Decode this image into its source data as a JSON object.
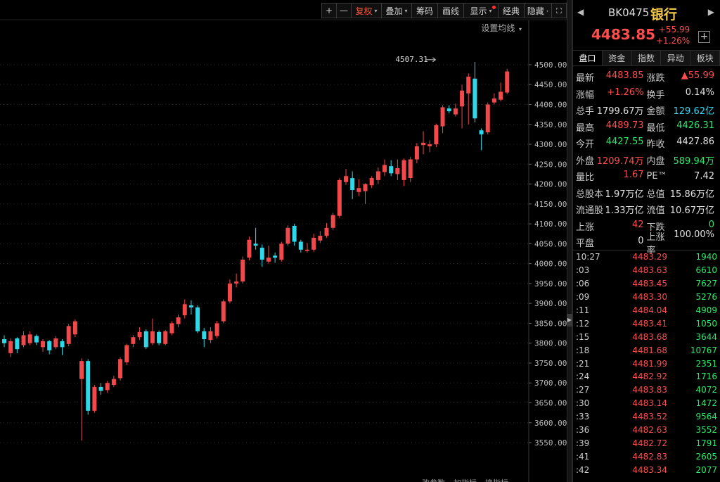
{
  "toolbar": {
    "items": [
      "+",
      "—",
      "复权",
      "叠加",
      "筹码",
      "画线",
      "显示",
      "经典",
      "隐藏"
    ],
    "active_index": 2,
    "fullscreen_icon": "expand-icon"
  },
  "ma_setting_label": "设置均线",
  "bottom_tabs": [
    "改参数",
    "加指标",
    "换指标"
  ],
  "chart_data": {
    "type": "candlestick",
    "ylim": [
      3520,
      4530
    ],
    "yticks": [
      4500,
      4450,
      4400,
      4350,
      4300,
      4250,
      4200,
      4150,
      4100,
      4050,
      4000,
      3950,
      3900,
      3850,
      3800,
      3750,
      3700,
      3650,
      3600,
      3550
    ],
    "ytick_labels": [
      "4500.00",
      "4450.00",
      "4400.00",
      "4350.00",
      "4300.00",
      "4250.00",
      "4200.00",
      "4150.00",
      "4100.00",
      "4050.00",
      "4000.00",
      "3950.00",
      "3900.00",
      "3850.00",
      "3800.00",
      "3750.00",
      "3700.00",
      "3650.00",
      "3600.00",
      "3550.00"
    ],
    "max_annotation": {
      "label": "4507.31",
      "value": 4507.31,
      "index": 67
    },
    "candles": [
      [
        3810,
        3800,
        3820,
        3790
      ],
      [
        3775,
        3805,
        3812,
        3765
      ],
      [
        3812,
        3785,
        3815,
        3775
      ],
      [
        3795,
        3820,
        3830,
        3790
      ],
      [
        3800,
        3822,
        3830,
        3795
      ],
      [
        3818,
        3802,
        3822,
        3795
      ],
      [
        3790,
        3805,
        3810,
        3778
      ],
      [
        3805,
        3782,
        3808,
        3772
      ],
      [
        3790,
        3812,
        3818,
        3785
      ],
      [
        3805,
        3790,
        3810,
        3770
      ],
      [
        3798,
        3843,
        3848,
        3792
      ],
      [
        3822,
        3855,
        3860,
        3815
      ],
      [
        3710,
        3755,
        3762,
        3555
      ],
      [
        3755,
        3630,
        3760,
        3620
      ],
      [
        3630,
        3690,
        3695,
        3625
      ],
      [
        3690,
        3680,
        3700,
        3670
      ],
      [
        3682,
        3700,
        3705,
        3675
      ],
      [
        3695,
        3710,
        3718,
        3690
      ],
      [
        3712,
        3760,
        3765,
        3706
      ],
      [
        3752,
        3795,
        3798,
        3745
      ],
      [
        3798,
        3815,
        3820,
        3790
      ],
      [
        3815,
        3828,
        3840,
        3808
      ],
      [
        3830,
        3790,
        3835,
        3785
      ],
      [
        3800,
        3830,
        3862,
        3795
      ],
      [
        3828,
        3800,
        3832,
        3795
      ],
      [
        3798,
        3830,
        3833,
        3795
      ],
      [
        3825,
        3850,
        3855,
        3820
      ],
      [
        3848,
        3865,
        3872,
        3840
      ],
      [
        3870,
        3898,
        3910,
        3862
      ],
      [
        3895,
        3890,
        3908,
        3872
      ],
      [
        3890,
        3830,
        3895,
        3825
      ],
      [
        3830,
        3810,
        3838,
        3790
      ],
      [
        3808,
        3830,
        3840,
        3800
      ],
      [
        3818,
        3850,
        3856,
        3812
      ],
      [
        3855,
        3905,
        3910,
        3850
      ],
      [
        3905,
        3950,
        3960,
        3900
      ],
      [
        3950,
        3955,
        3975,
        3940
      ],
      [
        3955,
        4010,
        4018,
        3950
      ],
      [
        4015,
        4060,
        4068,
        4008
      ],
      [
        4050,
        4045,
        4090,
        4035
      ],
      [
        4040,
        4010,
        4048,
        3992
      ],
      [
        4005,
        4015,
        4045,
        4000
      ],
      [
        4020,
        4015,
        4028,
        4002
      ],
      [
        4010,
        4050,
        4055,
        4005
      ],
      [
        4050,
        4090,
        4096,
        4045
      ],
      [
        4095,
        4055,
        4100,
        4045
      ],
      [
        4055,
        4035,
        4060,
        4028
      ],
      [
        4032,
        4035,
        4052,
        4028
      ],
      [
        4035,
        4065,
        4075,
        4030
      ],
      [
        4058,
        4070,
        4082,
        4052
      ],
      [
        4070,
        4090,
        4102,
        4065
      ],
      [
        4090,
        4122,
        4128,
        4085
      ],
      [
        4120,
        4210,
        4215,
        4115
      ],
      [
        4205,
        4220,
        4238,
        4198
      ],
      [
        4215,
        4185,
        4232,
        4162
      ],
      [
        4180,
        4190,
        4212,
        4170
      ],
      [
        4182,
        4200,
        4202,
        4150
      ],
      [
        4197,
        4215,
        4220,
        4190
      ],
      [
        4210,
        4232,
        4242,
        4200
      ],
      [
        4230,
        4248,
        4262,
        4220
      ],
      [
        4245,
        4227,
        4260,
        4220
      ],
      [
        4225,
        4240,
        4262,
        4210
      ],
      [
        4210,
        4260,
        4264,
        4195
      ],
      [
        4215,
        4262,
        4268,
        4205
      ],
      [
        4262,
        4295,
        4303,
        4252
      ],
      [
        4298,
        4304,
        4333,
        4275
      ],
      [
        4295,
        4300,
        4310,
        4280
      ],
      [
        4300,
        4348,
        4352,
        4293
      ],
      [
        4345,
        4393,
        4398,
        4328
      ],
      [
        4390,
        4383,
        4398,
        4378
      ],
      [
        4375,
        4390,
        4402,
        4370
      ],
      [
        4395,
        4435,
        4450,
        4340
      ],
      [
        4428,
        4470,
        4478,
        4350
      ],
      [
        4465,
        4365,
        4507,
        4355
      ],
      [
        4335,
        4325,
        4340,
        4285
      ],
      [
        4330,
        4400,
        4405,
        4325
      ],
      [
        4405,
        4415,
        4428,
        4400
      ],
      [
        4412,
        4432,
        4455,
        4408
      ],
      [
        4430,
        4483,
        4490,
        4426
      ]
    ]
  },
  "panel": {
    "nav_left_icon": "triangle-left-icon",
    "nav_right_icon": "triangle-right-icon",
    "code": "BK0475",
    "name": "银行",
    "price": "4483.85",
    "change": "+55.99",
    "change_pct": "+1.26%",
    "add_icon": "plus-box-icon",
    "tabs": [
      "盘口",
      "资金",
      "指数",
      "异动",
      "板块"
    ],
    "quote": [
      [
        {
          "label": "最新",
          "value": "4483.85",
          "color": "red"
        },
        {
          "label": "涨跌",
          "value": "▲55.99",
          "color": "red"
        }
      ],
      [
        {
          "label": "涨幅",
          "value": "+1.26%",
          "color": "red"
        },
        {
          "label": "换手",
          "value": "0.14%",
          "color": "white"
        }
      ],
      [
        {
          "label": "总手",
          "value": "1799.67万",
          "color": "white"
        },
        {
          "label": "金额",
          "value": "129.62亿",
          "color": "cyan"
        }
      ],
      [
        {
          "label": "最高",
          "value": "4489.73",
          "color": "red"
        },
        {
          "label": "最低",
          "value": "4426.31",
          "color": "green"
        }
      ],
      [
        {
          "label": "今开",
          "value": "4427.55",
          "color": "green"
        },
        {
          "label": "昨收",
          "value": "4427.86",
          "color": "white"
        }
      ],
      [
        {
          "label": "外盘",
          "value": "1209.74万",
          "color": "red"
        },
        {
          "label": "内盘",
          "value": "589.94万",
          "color": "green"
        }
      ],
      [
        {
          "label": "量比",
          "value": "1.67",
          "color": "red"
        },
        {
          "label": "PE™",
          "value": "7.42",
          "color": "white"
        }
      ],
      [
        {
          "label": "总股本",
          "value": "1.97万亿",
          "color": "white"
        },
        {
          "label": "总值",
          "value": "15.86万亿",
          "color": "white"
        }
      ],
      [
        {
          "label": "流通股",
          "value": "1.33万亿",
          "color": "white"
        },
        {
          "label": "流值",
          "value": "10.67万亿",
          "color": "white"
        }
      ],
      [
        {
          "label": "上涨",
          "value": "42",
          "color": "red"
        },
        {
          "label": "下跌",
          "value": "0",
          "color": "green"
        }
      ],
      [
        {
          "label": "平盘",
          "value": "0",
          "color": "white"
        },
        {
          "label": "上涨率",
          "value": "100.00%",
          "color": "white"
        }
      ]
    ],
    "ticks": [
      {
        "time": "10:27",
        "price": "4483.29",
        "vol": "1940"
      },
      {
        "time": ":03",
        "price": "4483.63",
        "vol": "6610"
      },
      {
        "time": ":06",
        "price": "4483.45",
        "vol": "7627"
      },
      {
        "time": ":09",
        "price": "4483.30",
        "vol": "5276"
      },
      {
        "time": ":11",
        "price": "4484.04",
        "vol": "4909"
      },
      {
        "time": ":12",
        "price": "4483.41",
        "vol": "1050"
      },
      {
        "time": ":15",
        "price": "4483.68",
        "vol": "3644"
      },
      {
        "time": ":18",
        "price": "4481.68",
        "vol": "10767"
      },
      {
        "time": ":21",
        "price": "4481.99",
        "vol": "2351"
      },
      {
        "time": ":24",
        "price": "4482.92",
        "vol": "1716"
      },
      {
        "time": ":27",
        "price": "4483.83",
        "vol": "4072"
      },
      {
        "time": ":30",
        "price": "4483.14",
        "vol": "1472"
      },
      {
        "time": ":33",
        "price": "4483.52",
        "vol": "9564"
      },
      {
        "time": ":36",
        "price": "4482.63",
        "vol": "3552"
      },
      {
        "time": ":39",
        "price": "4482.72",
        "vol": "1791"
      },
      {
        "time": ":41",
        "price": "4482.83",
        "vol": "2605"
      },
      {
        "time": ":42",
        "price": "4483.34",
        "vol": "2077"
      }
    ]
  },
  "colors": {
    "up": "#f0484b",
    "down": "#2fd8e8",
    "grid": "#2a2a2a",
    "label": "#b8b8b8"
  }
}
